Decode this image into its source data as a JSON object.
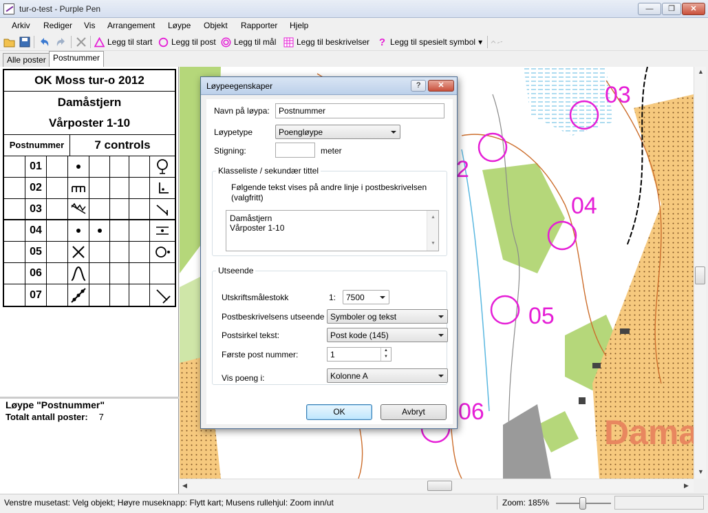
{
  "window": {
    "title": "tur-o-test - Purple Pen",
    "min": "—",
    "max": "❐",
    "close": "✕"
  },
  "menu": [
    "Arkiv",
    "Rediger",
    "Vis",
    "Arrangement",
    "Løype",
    "Objekt",
    "Rapporter",
    "Hjelp"
  ],
  "toolbar": {
    "add_start": "Legg til start",
    "add_control": "Legg til post",
    "add_finish": "Legg til mål",
    "add_descriptions": "Legg til beskrivelser",
    "add_special": "Legg til spesielt symbol",
    "dropdown_arrow": "▾"
  },
  "tabs": [
    "Alle poster",
    "Postnummer"
  ],
  "description": {
    "event_title": "OK Moss tur-o 2012",
    "course_name": "Damåstjern",
    "class_line": "Vårposter 1-10",
    "count_label": "Postnummer",
    "count_value": "7 controls",
    "controls": [
      {
        "code": "01",
        "col_d": "dot",
        "col_h": "circle-stem"
      },
      {
        "code": "02",
        "col_d": "comb",
        "col_h": "corner-dot"
      },
      {
        "code": "03",
        "col_d": "zigzag",
        "col_h": "slash-line"
      },
      {
        "code": "04",
        "col_d": "dot",
        "col_e": "dot",
        "col_h": "between-lines"
      },
      {
        "code": "05",
        "col_d": "cross",
        "col_h": "circle-dot"
      },
      {
        "code": "06",
        "col_d": "bell",
        "col_h": ""
      },
      {
        "code": "07",
        "col_d": "chain",
        "col_h": "t-shape"
      }
    ]
  },
  "course_info": {
    "title": "Løype \"Postnummer\"",
    "total_label": "Totalt antall poster:",
    "total_value": "7"
  },
  "map": {
    "control_labels": [
      "03",
      "2",
      "04",
      "05",
      "06"
    ],
    "place_name": "Dama",
    "colors": {
      "course": "#e51ed6",
      "forest": "#ffffff",
      "open": "#f6c97e",
      "green": "#b5d77a",
      "water": "#9ed7f0",
      "contour": "#cc6d2b"
    }
  },
  "dialog": {
    "title": "Løypeegenskaper",
    "help": "?",
    "close": "✕",
    "name_label": "Navn på løypa:",
    "name_value": "Postnummer",
    "type_label": "Løypetype",
    "type_value": "Poengløype",
    "climb_label": "Stigning:",
    "climb_value": "",
    "climb_unit": "meter",
    "class_group_title": "Klasseliste / sekundær tittel",
    "class_help": "Følgende tekst vises på andre linje i postbeskrivelsen (valgfritt)",
    "class_text": [
      "Damåstjern",
      "Vårposter 1-10"
    ],
    "look_group_title": "Utseende",
    "scale_label": "Utskriftsmålestokk",
    "scale_prefix": "1:",
    "scale_value": "7500",
    "desc_kind_label": "Postbeskrivelsens utseende",
    "desc_kind_value": "Symboler og tekst",
    "circle_text_label": "Postsirkel tekst:",
    "circle_text_value": "Post kode (145)",
    "first_number_label": "Første post nummer:",
    "first_number_value": "1",
    "points_label": "Vis poeng i:",
    "points_value": "Kolonne A",
    "ok": "OK",
    "cancel": "Avbryt"
  },
  "status": {
    "message": "Venstre musetast: Velg objekt; Høyre museknapp: Flytt kart; Musens rullehjul: Zoom inn/ut",
    "zoom": "Zoom: 185%"
  }
}
